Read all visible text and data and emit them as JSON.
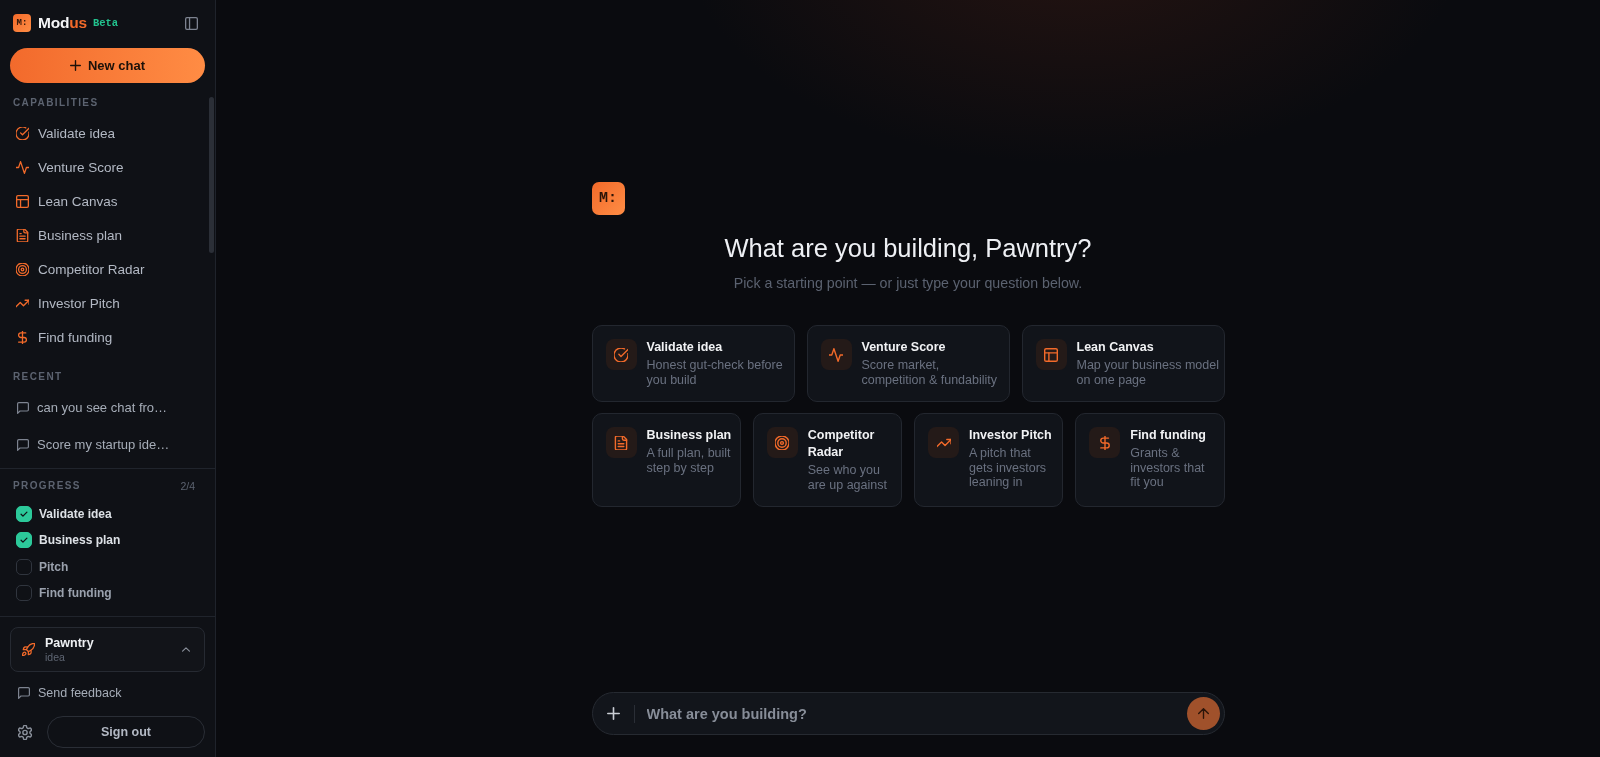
{
  "sidebar": {
    "brand": {
      "logo": "M:",
      "name": [
        {
          "text": "Mod",
          "accent": false
        },
        {
          "text": "us",
          "accent": true
        }
      ],
      "badge": "Beta"
    },
    "new_chat_button": "New chat",
    "capabilities": {
      "heading": "CAPABILITIES",
      "items": [
        {
          "label": "Validate idea"
        },
        {
          "label": "Venture Score"
        },
        {
          "label": "Lean Canvas"
        },
        {
          "label": "Business plan"
        },
        {
          "label": "Competitor Radar"
        },
        {
          "label": "Investor Pitch"
        },
        {
          "label": "Find funding"
        }
      ]
    },
    "recent": {
      "heading": "RECENT",
      "items": [
        {
          "title": "can you see chat fro…"
        },
        {
          "title": "Score my startup ide…"
        }
      ]
    },
    "progress": {
      "heading": "PROGRESS",
      "count": "2/4",
      "items": [
        {
          "label": "Validate idea",
          "checked": true
        },
        {
          "label": "Business plan",
          "checked": true
        },
        {
          "label": "Pitch",
          "checked": false
        },
        {
          "label": "Find funding",
          "checked": false
        }
      ]
    },
    "project": {
      "name": "Pawntry",
      "stage": "idea"
    },
    "feedback_link": "Send feedback",
    "sign_out_button": "Sign out"
  },
  "main": {
    "logo": "M:",
    "heading": "What are you building, Pawntry?",
    "subheading": "Pick a starting point — or just type your question below.",
    "card_rows": [
      [
        {
          "title": "Validate idea",
          "description": "Honest gut-check before you build"
        },
        {
          "title": "Venture Score",
          "description": "Score market, competition & fundability"
        },
        {
          "title": "Lean Canvas",
          "description": "Map your business model on one page"
        }
      ],
      [
        {
          "title": "Business plan",
          "description": "A full plan, built step by step"
        },
        {
          "title": "Competitor Radar",
          "description": "See who you are up against"
        },
        {
          "title": "Investor Pitch",
          "description": "A pitch that gets investors leaning in"
        },
        {
          "title": "Find funding",
          "description": "Grants & investors that fit you"
        }
      ]
    ],
    "composer": {
      "placeholder": "What are you building?"
    }
  }
}
